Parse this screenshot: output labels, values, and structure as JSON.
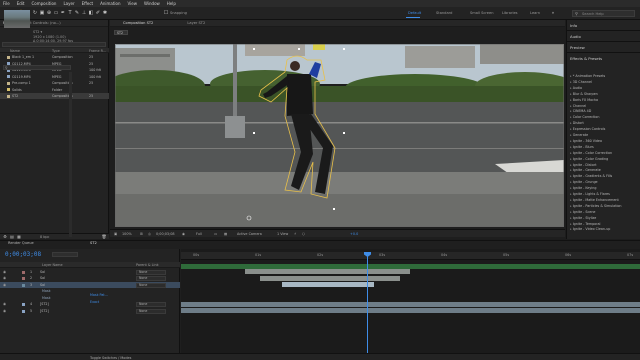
{
  "menubar": [
    "File",
    "Edit",
    "Composition",
    "Layer",
    "Effect",
    "Animation",
    "View",
    "Window",
    "Help"
  ],
  "toolbar": {
    "snapping_label": "Snapping",
    "workspaces": [
      {
        "label": "Default",
        "active": true
      },
      {
        "label": "Standard",
        "active": false
      },
      {
        "label": "Small Screen",
        "active": false
      },
      {
        "label": "Libraries",
        "active": false
      },
      {
        "label": "Learn",
        "active": false
      }
    ],
    "search_placeholder": "Search Help"
  },
  "project": {
    "tabs": [
      "Project",
      "Effect Controls: (no...)"
    ],
    "info_name": "ST2 ▾",
    "info_line1": "1920 x 1080 (1.00)",
    "info_line2": "Δ 0;00;14;00, 29.97 fps",
    "columns": {
      "name": "Name",
      "type": "Type",
      "frame_rate": "Frame R..."
    },
    "rows": [
      {
        "name": "Black 1_em 1",
        "type": "Composition",
        "rate": "25",
        "color": "#c4b48a",
        "selected": false
      },
      {
        "name": "C0112.MP4",
        "type": "MPEG",
        "rate": "25",
        "color": "#8aa3c4",
        "selected": false
      },
      {
        "name": "C0115.MP4",
        "type": "MPEG",
        "rate": "100 fdt",
        "color": "#8aa3c4",
        "selected": false
      },
      {
        "name": "C0119.MP4",
        "type": "MPEG",
        "rate": "100 fdt",
        "color": "#8aa3c4",
        "selected": false
      },
      {
        "name": "Pre-comp 1",
        "type": "Composition",
        "rate": "25",
        "color": "#c4b48a",
        "selected": false
      },
      {
        "name": "Solids",
        "type": "Folder",
        "rate": "",
        "color": "#d7c16a",
        "selected": false
      },
      {
        "name": "ST2",
        "type": "Composition",
        "rate": "25",
        "color": "#c4b48a",
        "selected": true
      }
    ],
    "footer_bpc": "8 bpc"
  },
  "viewer": {
    "tabs": [
      "Composition ST2",
      "Layer ST2"
    ],
    "breadcrumb": "ST2",
    "footer": {
      "zoom": "100%",
      "timecode": "0;00;03;08",
      "resolution": "Full",
      "camera": "Active Camera",
      "views": "1 View",
      "offset": "+0.0"
    }
  },
  "right_panel": {
    "sections": [
      "Info",
      "Audio",
      "Preview",
      "Effects & Presets"
    ],
    "effects_list": [
      "* Animation Presets",
      "3D Channel",
      "Audio",
      "Blur & Sharpen",
      "Boris FX Mocha",
      "Channel",
      "CINEMA 4D",
      "Color Correction",
      "Distort",
      "Expression Controls",
      "Generate",
      "Ignite - 360 Video",
      "Ignite - Blurs",
      "Ignite - Color Correction",
      "Ignite - Color Grading",
      "Ignite - Distort",
      "Ignite - Generate",
      "Ignite - Gradients & Fills",
      "Ignite - Grunge",
      "Ignite - Keying",
      "Ignite - Lights & Flares",
      "Ignite - Matte Enhancement",
      "Ignite - Particles & Simulation",
      "Ignite - Scene",
      "Ignite - Stylize",
      "Ignite - Temporal",
      "Ignite - Video Clean-up"
    ]
  },
  "timeline": {
    "tabs": [
      "Render Queue",
      "ST2"
    ],
    "timecode": "0;00;03;08",
    "columns": {
      "layer_name": "Layer Name",
      "parent": "Parent & Link"
    },
    "layers": [
      {
        "num": "1",
        "name": "Sol",
        "parent": "None",
        "selected": false,
        "color": "#9e6a6a"
      },
      {
        "num": "2",
        "name": "Sol",
        "parent": "None",
        "selected": false,
        "color": "#9e6a6a"
      },
      {
        "num": "3",
        "name": "Sol",
        "parent": "None",
        "selected": true,
        "color": "#6a8a9e"
      },
      {
        "num": "",
        "name": "Mask",
        "parent": "",
        "selected": false,
        "color": ""
      },
      {
        "num": "",
        "name": "Mask",
        "parent": "",
        "selected": false,
        "color": ""
      },
      {
        "num": "4",
        "name": "[ST2]",
        "parent": "None",
        "selected": false,
        "color": "#8aa3c4"
      },
      {
        "num": "5",
        "name": "[ST2]",
        "parent": "None",
        "selected": false,
        "color": "#8aa3c4"
      }
    ],
    "mask_label_1": "Mask Pat...",
    "mask_label_2": "Exact",
    "ruler_labels": [
      "00s",
      "01s",
      "02s",
      "03s",
      "04s",
      "05s",
      "06s",
      "07s"
    ],
    "footer": "Toggle Switches / Modes"
  },
  "colors": {
    "accent": "#3f8de8"
  }
}
